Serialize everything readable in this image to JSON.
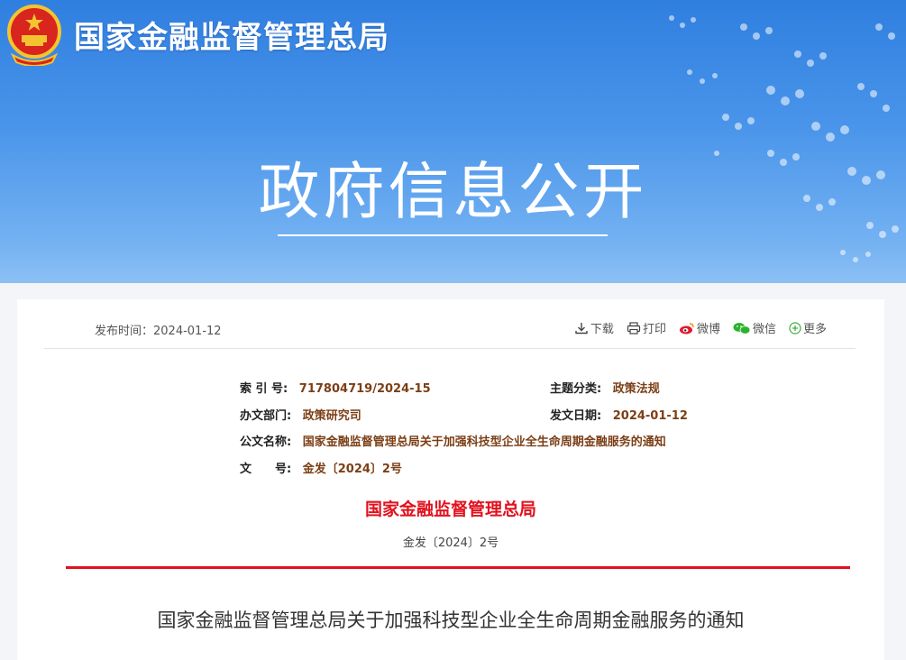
{
  "header": {
    "site_name": "国家金融监督管理总局",
    "hero_title": "政府信息公开"
  },
  "article": {
    "publish_date_label": "发布时间：",
    "publish_date": "2024-01-12",
    "toolbar": {
      "download": "下载",
      "print": "打印",
      "weibo": "微博",
      "wechat": "微信",
      "more": "更多"
    },
    "meta": {
      "index_label": "索 引 号:",
      "index_value": "717804719/2024-15",
      "topic_label": "主题分类:",
      "topic_value": "政策法规",
      "department_label": "办文部门:",
      "department_value": "政策研究司",
      "issue_date_label": "发文日期:",
      "issue_date_value": "2024-01-12",
      "doc_name_label": "公文名称:",
      "doc_name_value": "国家金融监督管理总局关于加强科技型企业全生命周期金融服务的通知",
      "doc_number_label": "文　　号:",
      "doc_number_value": "金发〔2024〕2号"
    },
    "issuer": "国家金融监督管理总局",
    "doc_number": "金发〔2024〕2号",
    "title": "国家金融监督管理总局关于加强科技型企业全生命周期金融服务的通知"
  },
  "colors": {
    "banner_blue": "#3d8ae6",
    "accent_red": "#e1121e",
    "meta_value_brown": "#7b3f16"
  }
}
